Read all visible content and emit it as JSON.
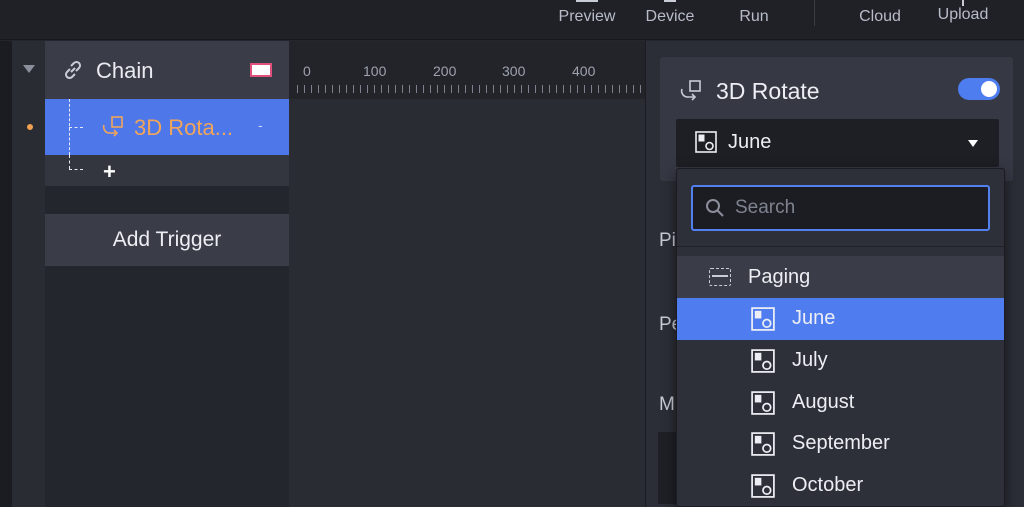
{
  "toolbar": {
    "preview_label": "Preview",
    "device_label": "Device",
    "run_label": "Run",
    "cloud_label": "Cloud",
    "upload_label": "Upload"
  },
  "chain": {
    "title": "Chain",
    "swatch_color": "#ffffff",
    "swatch_border": "#e0507a"
  },
  "interaction": {
    "label": "3D Rota...",
    "dash": "-",
    "label_color": "#f0a55a",
    "row_color": "#4e78ea"
  },
  "add_row": {
    "symbol": "+"
  },
  "add_trigger": {
    "label": "Add Trigger"
  },
  "timeline": {
    "ticks": [
      "0",
      "100",
      "200",
      "300",
      "400"
    ]
  },
  "inspector": {
    "title": "3D Rotate",
    "toggle_on": true,
    "accent": "#4e7df0",
    "target_select": {
      "value": "June"
    },
    "partial_labels": [
      "Pi",
      "Pe",
      "M"
    ]
  },
  "dropdown": {
    "search_placeholder": "Search",
    "group": "Paging",
    "items": [
      {
        "label": "June",
        "selected": true
      },
      {
        "label": "July",
        "selected": false
      },
      {
        "label": "August",
        "selected": false
      },
      {
        "label": "September",
        "selected": false
      },
      {
        "label": "October",
        "selected": false
      }
    ]
  }
}
